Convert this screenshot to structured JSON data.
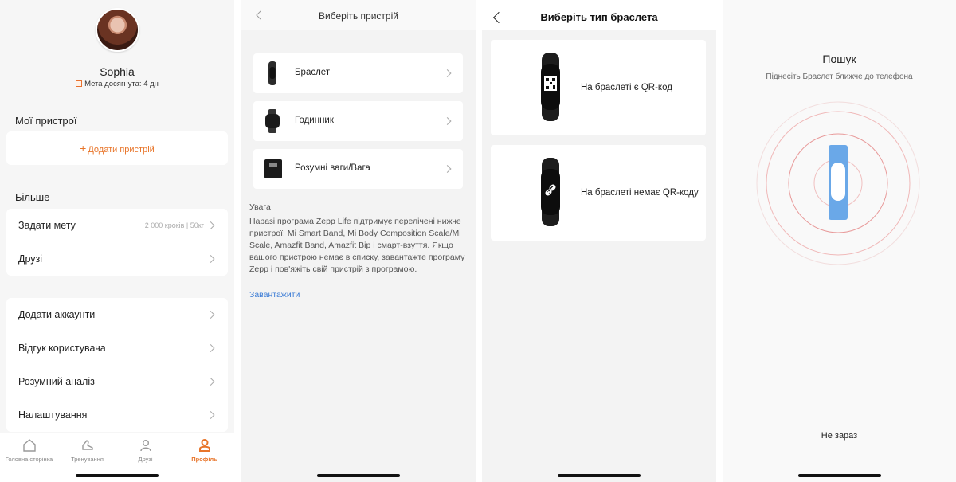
{
  "profile": {
    "name": "Sophia",
    "goal_text": "Мета досягнута: 4 дн",
    "my_devices_heading": "Мої пристрої",
    "add_device_label": "Додати пристрій",
    "more_heading": "Більше",
    "rows_group1": [
      {
        "label": "Задати мету",
        "value": "2 000 кроків | 50кг"
      },
      {
        "label": "Друзі",
        "value": ""
      }
    ],
    "rows_group2": [
      {
        "label": "Додати аккаунти"
      },
      {
        "label": "Відгук користувача"
      },
      {
        "label": "Розумний аналіз"
      },
      {
        "label": "Налаштування"
      }
    ],
    "tabs": [
      {
        "label": "Головна сторінка",
        "icon": "home-icon"
      },
      {
        "label": "Тренування",
        "icon": "shoe-icon"
      },
      {
        "label": "Друзі",
        "icon": "friends-icon"
      },
      {
        "label": "Профіль",
        "icon": "person-icon",
        "active": true
      }
    ],
    "accent": "#e8752a"
  },
  "select_device": {
    "title": "Виберіть пристрій",
    "devices": [
      {
        "label": "Браслет",
        "icon": "band-icon"
      },
      {
        "label": "Годинник",
        "icon": "watch-icon"
      },
      {
        "label": "Розумні ваги/Вага",
        "icon": "scale-icon"
      }
    ],
    "note_title": "Увага",
    "note_text": "Наразі програма Zepp Life підтримує перелічені нижче пристрої: Mi Smart Band, Mi Body Composition Scale/Mi Scale, Amazfit Band, Amazfit Bip і смарт-взуття. Якщо вашого пристрою немає в списку, завантажте програму Zepp і пов'яжіть свій пристрій з програмою.",
    "download_link": "Завантажити"
  },
  "band_type": {
    "title": "Виберіть тип браслета",
    "options": [
      {
        "label": "На браслеті є QR-код",
        "icon": "qr-code-icon"
      },
      {
        "label": "На браслеті немає QR-коду",
        "icon": "link-icon"
      }
    ]
  },
  "search": {
    "title": "Пошук",
    "subtitle": "Піднесіть Браслет ближче до телефона",
    "not_now": "Не зараз",
    "band_color": "#6aa8e8"
  }
}
